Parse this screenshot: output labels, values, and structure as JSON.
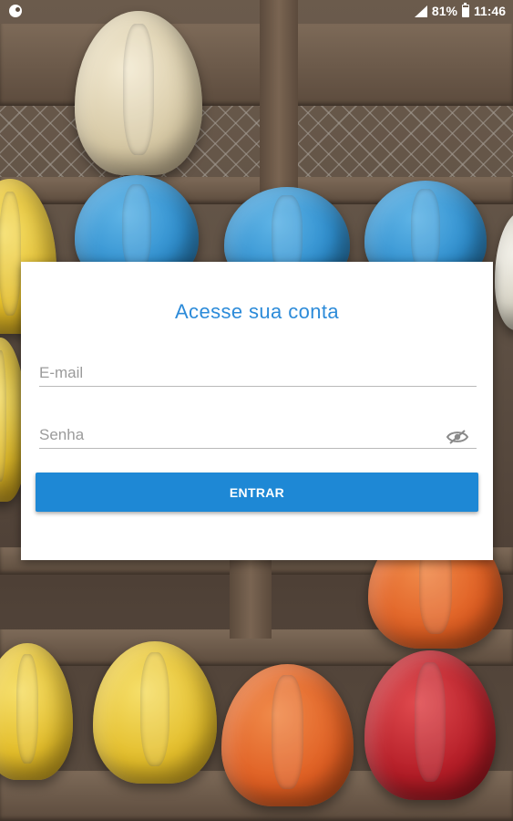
{
  "status_bar": {
    "battery_percent": "81%",
    "battery_level": 0.81,
    "time": "11:46",
    "icons": [
      "app-notification-icon",
      "signal-icon",
      "battery-icon"
    ]
  },
  "login": {
    "title": "Acesse sua conta",
    "email": {
      "value": "",
      "placeholder": "E-mail"
    },
    "password": {
      "value": "",
      "placeholder": "Senha",
      "toggle_icon": "eye-hidden-icon"
    },
    "submit_label": "ENTRAR"
  },
  "colors": {
    "accent": "#1e88d5",
    "title": "#2c8bd9",
    "card_background": "#ffffff"
  }
}
